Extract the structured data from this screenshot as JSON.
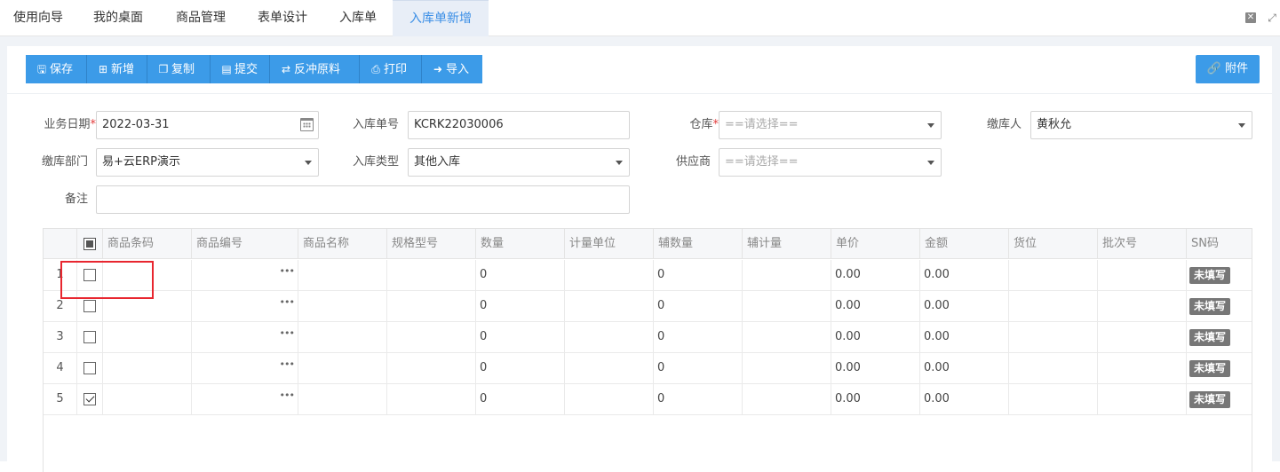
{
  "tabs": [
    {
      "label": "使用向导"
    },
    {
      "label": "我的桌面"
    },
    {
      "label": "商品管理"
    },
    {
      "label": "表单设计"
    },
    {
      "label": "入库单"
    },
    {
      "label": "入库单新增"
    }
  ],
  "window_controls": {
    "close_icon": "close-icon",
    "maximize_icon": "maximize-icon"
  },
  "toolbar": {
    "save": "保存",
    "add": "新增",
    "copy": "复制",
    "submit": "提交",
    "reverse": "反冲原料",
    "print": "打印",
    "import": "导入",
    "attach": "附件"
  },
  "form": {
    "business_date": {
      "label": "业务日期",
      "value": "2022-03-31"
    },
    "order_no": {
      "label": "入库单号",
      "value": "KCRK22030006"
    },
    "warehouse": {
      "label": "仓库",
      "placeholder": "==请选择=="
    },
    "payer": {
      "label": "缴库人",
      "value": "黄秋允"
    },
    "dept": {
      "label": "缴库部门",
      "value": "易+云ERP演示"
    },
    "stock_type": {
      "label": "入库类型",
      "value": "其他入库"
    },
    "supplier": {
      "label": "供应商",
      "placeholder": "==请选择=="
    },
    "remark": {
      "label": "备注",
      "value": ""
    }
  },
  "grid": {
    "columns": [
      "商品条码",
      "商品编号",
      "商品名称",
      "规格型号",
      "数量",
      "计量单位",
      "辅数量",
      "辅计量",
      "单价",
      "金额",
      "货位",
      "批次号",
      "SN码"
    ],
    "rows": [
      {
        "no": "1",
        "checked": false,
        "qty": "0",
        "aux_qty": "0",
        "price": "0.00",
        "amount": "0.00",
        "sn": "未填写"
      },
      {
        "no": "2",
        "checked": false,
        "qty": "0",
        "aux_qty": "0",
        "price": "0.00",
        "amount": "0.00",
        "sn": "未填写"
      },
      {
        "no": "3",
        "checked": false,
        "qty": "0",
        "aux_qty": "0",
        "price": "0.00",
        "amount": "0.00",
        "sn": "未填写"
      },
      {
        "no": "4",
        "checked": false,
        "qty": "0",
        "aux_qty": "0",
        "price": "0.00",
        "amount": "0.00",
        "sn": "未填写"
      },
      {
        "no": "5",
        "checked": true,
        "qty": "0",
        "aux_qty": "0",
        "price": "0.00",
        "amount": "0.00",
        "sn": "未填写"
      }
    ]
  },
  "colors": {
    "accent": "#3c9be8",
    "active_tab_text": "#3a8ee6",
    "highlight": "#e8262f",
    "required": "#e23c3c"
  }
}
